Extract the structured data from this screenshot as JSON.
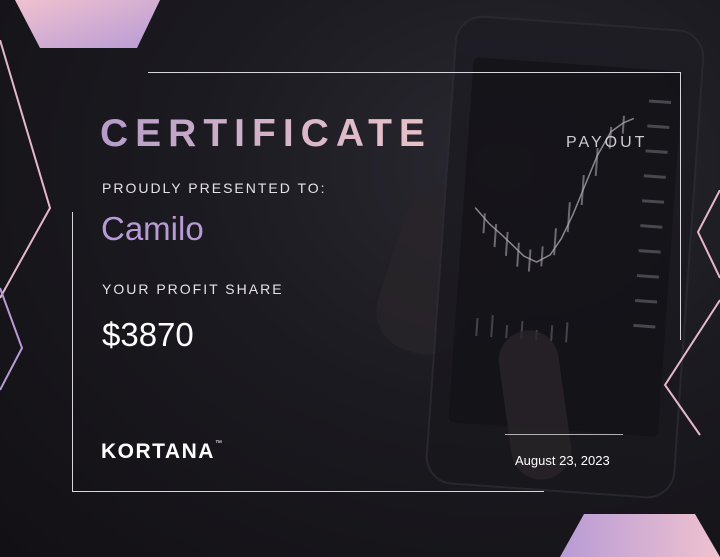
{
  "certificate": {
    "title": "CERTIFICATE",
    "payout_label": "PAYOUT",
    "presented_label": "PROUDLY PRESENTED TO:",
    "recipient_name": "Camilo",
    "profit_share_label": "YOUR PROFIT SHARE",
    "profit_share_amount": "$3870",
    "brand": "KORTANA",
    "trademark": "™",
    "date": "August 23, 2023"
  },
  "colors": {
    "background": "#1b1a20",
    "accent_purple": "#b89bd6",
    "accent_pink": "#e9c2c8",
    "frame_line": "#d9d5dc",
    "text": "#ffffff"
  }
}
